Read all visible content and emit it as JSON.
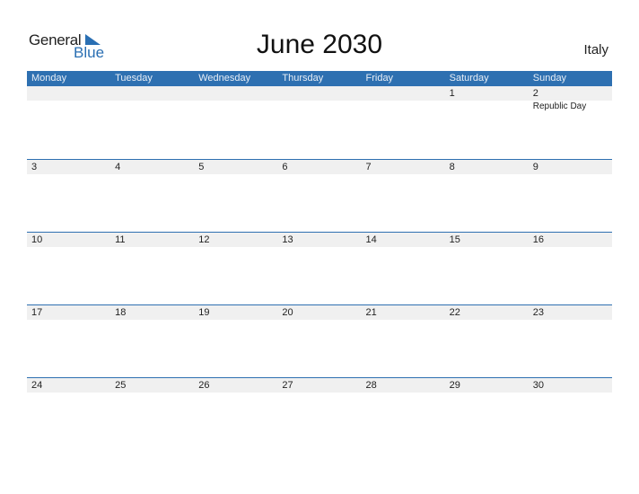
{
  "logo": {
    "general": "General",
    "blue": "Blue"
  },
  "title": "June 2030",
  "country": "Italy",
  "colors": {
    "accent": "#2e70b1",
    "strip": "#f0f0f0"
  },
  "weekdays": [
    "Monday",
    "Tuesday",
    "Wednesday",
    "Thursday",
    "Friday",
    "Saturday",
    "Sunday"
  ],
  "weeks": [
    [
      {
        "day": ""
      },
      {
        "day": ""
      },
      {
        "day": ""
      },
      {
        "day": ""
      },
      {
        "day": ""
      },
      {
        "day": "1"
      },
      {
        "day": "2",
        "event": "Republic Day"
      }
    ],
    [
      {
        "day": "3"
      },
      {
        "day": "4"
      },
      {
        "day": "5"
      },
      {
        "day": "6"
      },
      {
        "day": "7"
      },
      {
        "day": "8"
      },
      {
        "day": "9"
      }
    ],
    [
      {
        "day": "10"
      },
      {
        "day": "11"
      },
      {
        "day": "12"
      },
      {
        "day": "13"
      },
      {
        "day": "14"
      },
      {
        "day": "15"
      },
      {
        "day": "16"
      }
    ],
    [
      {
        "day": "17"
      },
      {
        "day": "18"
      },
      {
        "day": "19"
      },
      {
        "day": "20"
      },
      {
        "day": "21"
      },
      {
        "day": "22"
      },
      {
        "day": "23"
      }
    ],
    [
      {
        "day": "24"
      },
      {
        "day": "25"
      },
      {
        "day": "26"
      },
      {
        "day": "27"
      },
      {
        "day": "28"
      },
      {
        "day": "29"
      },
      {
        "day": "30"
      }
    ]
  ]
}
